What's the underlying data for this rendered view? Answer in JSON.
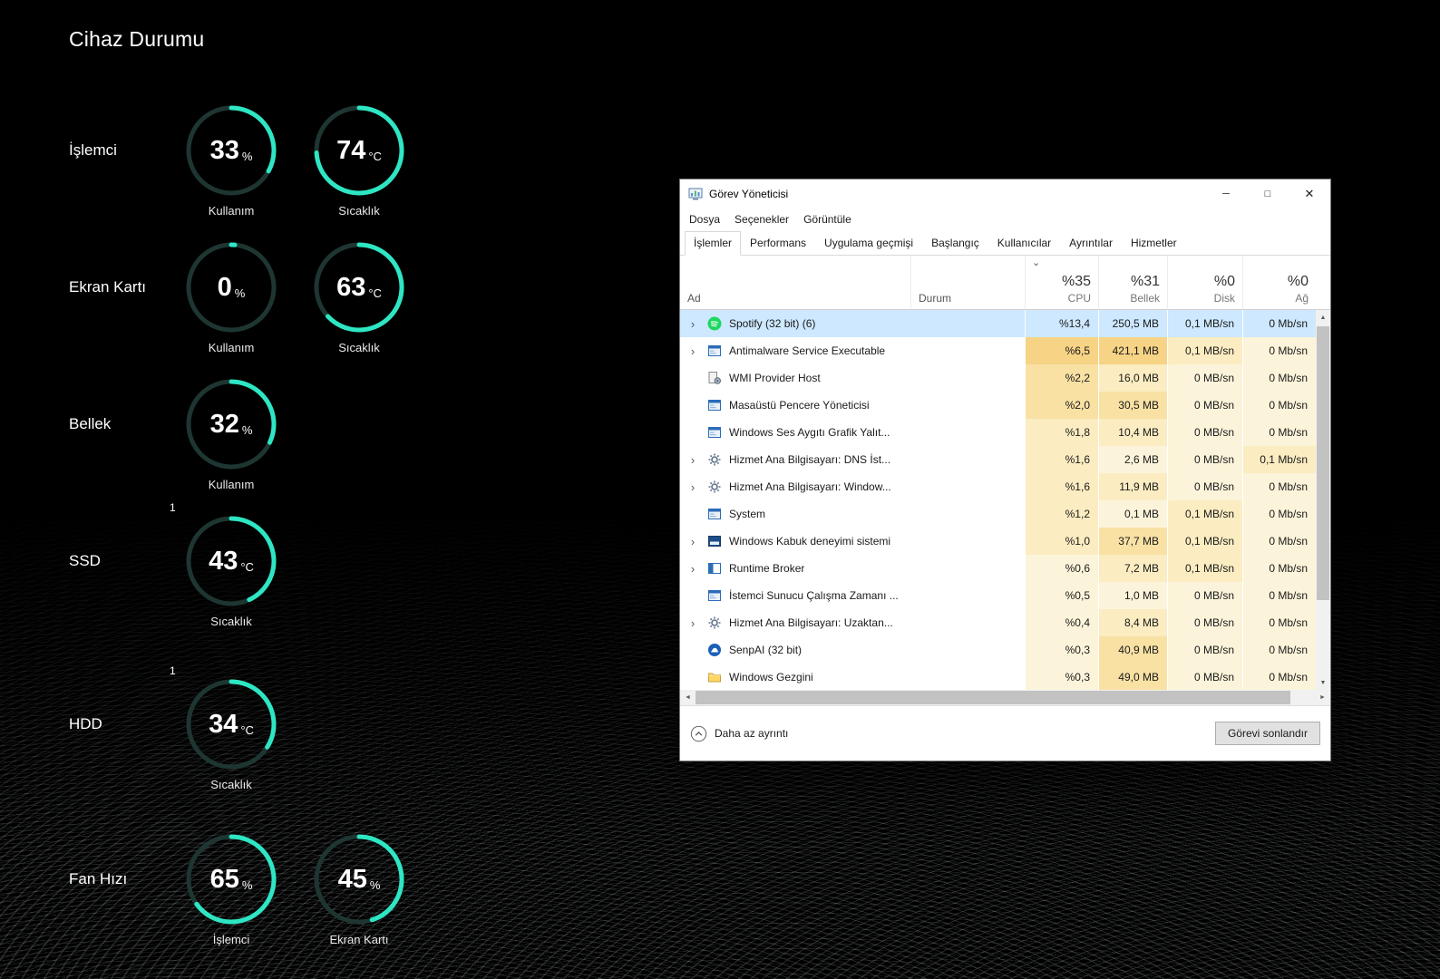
{
  "device_status": {
    "title": "Cihaz Durumu",
    "accent_color": "#2ee6c3",
    "rows": [
      {
        "label": "İşlemci",
        "gauges": [
          {
            "value": "33",
            "unit": "%",
            "caption": "Kullanım",
            "percent": 33
          },
          {
            "value": "74",
            "unit": "°C",
            "caption": "Sıcaklık",
            "percent": 74
          }
        ]
      },
      {
        "label": "Ekran Kartı",
        "gauges": [
          {
            "value": "0",
            "unit": "%",
            "caption": "Kullanım",
            "percent": 0
          },
          {
            "value": "63",
            "unit": "°C",
            "caption": "Sıcaklık",
            "percent": 63
          }
        ]
      },
      {
        "label": "Bellek",
        "gauges": [
          {
            "value": "32",
            "unit": "%",
            "caption": "Kullanım",
            "percent": 32
          }
        ]
      },
      {
        "label": "SSD",
        "footnote": "1",
        "gauges": [
          {
            "value": "43",
            "unit": "°C",
            "caption": "Sıcaklık",
            "percent": 43
          }
        ]
      },
      {
        "label": "HDD",
        "footnote": "1",
        "gauges": [
          {
            "value": "34",
            "unit": "°C",
            "caption": "Sıcaklık",
            "percent": 34
          }
        ]
      },
      {
        "label": "Fan Hızı",
        "gauges": [
          {
            "value": "65",
            "unit": "%",
            "caption": "İşlemci",
            "percent": 65
          },
          {
            "value": "45",
            "unit": "%",
            "caption": "Ekran Kartı",
            "percent": 45
          }
        ]
      }
    ]
  },
  "task_manager": {
    "window_title": "Görev Yöneticisi",
    "window_controls": {
      "minimize": "─",
      "maximize": "□",
      "close": "✕"
    },
    "menu_items": [
      "Dosya",
      "Seçenekler",
      "Görüntüle"
    ],
    "tabs": [
      {
        "label": "İşlemler",
        "active": true
      },
      {
        "label": "Performans",
        "active": false
      },
      {
        "label": "Uygulama geçmişi",
        "active": false
      },
      {
        "label": "Başlangıç",
        "active": false
      },
      {
        "label": "Kullanıcılar",
        "active": false
      },
      {
        "label": "Ayrıntılar",
        "active": false
      },
      {
        "label": "Hizmetler",
        "active": false
      }
    ],
    "columns": {
      "name": "Ad",
      "status": "Durum",
      "cpu": {
        "total": "%35",
        "label": "CPU"
      },
      "memory": {
        "total": "%31",
        "label": "Bellek"
      },
      "disk": {
        "total": "%0",
        "label": "Disk"
      },
      "network": {
        "total": "%0",
        "label": "Ağ"
      }
    },
    "icons": {
      "sort_descending": "⌄",
      "expander_chevron": "›",
      "scroll_up": "▲",
      "scroll_down": "▼",
      "scroll_left": "◄",
      "scroll_right": "►"
    },
    "processes": [
      {
        "name": "Spotify (32 bit) (6)",
        "icon": "spotify",
        "expandable": true,
        "selected": true,
        "cpu": "%13,4",
        "memory": "250,5 MB",
        "disk": "0,1 MB/sn",
        "network": "0 Mb/sn"
      },
      {
        "name": "Antimalware Service Executable",
        "icon": "window",
        "expandable": true,
        "cpu": "%6,5",
        "memory": "421,1 MB",
        "disk": "0,1 MB/sn",
        "network": "0 Mb/sn"
      },
      {
        "name": "WMI Provider Host",
        "icon": "wmi",
        "cpu": "%2,2",
        "memory": "16,0 MB",
        "disk": "0 MB/sn",
        "network": "0 Mb/sn"
      },
      {
        "name": "Masaüstü Pencere Yöneticisi",
        "icon": "window",
        "cpu": "%2,0",
        "memory": "30,5 MB",
        "disk": "0 MB/sn",
        "network": "0 Mb/sn"
      },
      {
        "name": "Windows Ses Aygıtı Grafik Yalıt...",
        "icon": "window",
        "cpu": "%1,8",
        "memory": "10,4 MB",
        "disk": "0 MB/sn",
        "network": "0 Mb/sn"
      },
      {
        "name": "Hizmet Ana Bilgisayarı: DNS İst...",
        "icon": "gear",
        "expandable": true,
        "cpu": "%1,6",
        "memory": "2,6 MB",
        "disk": "0 MB/sn",
        "network": "0,1 Mb/sn"
      },
      {
        "name": "Hizmet Ana Bilgisayarı: Window...",
        "icon": "gear",
        "expandable": true,
        "cpu": "%1,6",
        "memory": "11,9 MB",
        "disk": "0 MB/sn",
        "network": "0 Mb/sn"
      },
      {
        "name": "System",
        "icon": "window",
        "cpu": "%1,2",
        "memory": "0,1 MB",
        "disk": "0,1 MB/sn",
        "network": "0 Mb/sn"
      },
      {
        "name": "Windows Kabuk deneyimi sistemi",
        "icon": "shell",
        "expandable": true,
        "cpu": "%1,0",
        "memory": "37,7 MB",
        "disk": "0,1 MB/sn",
        "network": "0 Mb/sn"
      },
      {
        "name": "Runtime Broker",
        "icon": "runtime",
        "expandable": true,
        "cpu": "%0,6",
        "memory": "7,2 MB",
        "disk": "0,1 MB/sn",
        "network": "0 Mb/sn"
      },
      {
        "name": "İstemci Sunucu Çalışma Zamanı ...",
        "icon": "window",
        "cpu": "%0,5",
        "memory": "1,0 MB",
        "disk": "0 MB/sn",
        "network": "0 Mb/sn"
      },
      {
        "name": "Hizmet Ana Bilgisayarı: Uzaktan...",
        "icon": "gear",
        "expandable": true,
        "cpu": "%0,4",
        "memory": "8,4 MB",
        "disk": "0 MB/sn",
        "network": "0 Mb/sn"
      },
      {
        "name": "SenpAI (32 bit)",
        "icon": "senpai",
        "cpu": "%0,3",
        "memory": "40,9 MB",
        "disk": "0 MB/sn",
        "network": "0 Mb/sn"
      },
      {
        "name": "Windows Gezgini",
        "icon": "folder",
        "cpu": "%0,3",
        "memory": "49,0 MB",
        "disk": "0 MB/sn",
        "network": "0 Mb/sn"
      }
    ],
    "footer": {
      "less_detail_label": "Daha az ayrıntı",
      "end_task_label": "Görevi sonlandır"
    },
    "selection_color": "#cde8ff",
    "heat_palette": [
      "#fdfaf0",
      "#fcf4da",
      "#fbecc1",
      "#f9e1a4",
      "#f6d385",
      "#f2c05e"
    ]
  }
}
